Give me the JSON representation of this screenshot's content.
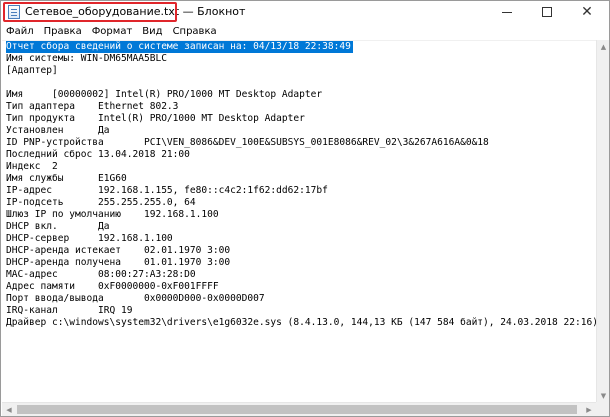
{
  "window": {
    "title": "Сетевое_оборудование.txt — Блокнот",
    "app_icon": "notepad-icon",
    "buttons": {
      "minimize": "—",
      "maximize": "☐",
      "close": "✕"
    }
  },
  "menu": {
    "items": [
      {
        "label": "Файл"
      },
      {
        "label": "Правка"
      },
      {
        "label": "Формат"
      },
      {
        "label": "Вид"
      },
      {
        "label": "Справка"
      }
    ]
  },
  "editor": {
    "selection_color": "#0078d7",
    "lines": [
      "Отчет сбора сведений о системе записан на: 04/13/18 22:38:49",
      "Имя системы: WIN-DM65MAA5BLC",
      "[Адаптер]",
      "",
      "Имя     [00000002] Intel(R) PRO/1000 MT Desktop Adapter",
      "Тип адаптера    Ethernet 802.3",
      "Тип продукта    Intel(R) PRO/1000 MT Desktop Adapter",
      "Установлен      Да",
      "ID PNP-устройства       PCI\\VEN_8086&DEV_100E&SUBSYS_001E8086&REV_02\\3&267A616A&0&18",
      "Последний сброс 13.04.2018 21:00",
      "Индекс  2",
      "Имя службы      E1G60",
      "IP-адрес        192.168.1.155, fe80::c4c2:1f62:dd62:17bf",
      "IP-подсеть      255.255.255.0, 64",
      "Шлюз IP по умолчанию    192.168.1.100",
      "DHCP вкл.       Да",
      "DHCP-сервер     192.168.1.100",
      "DHCP-аренда истекает    02.01.1970 3:00",
      "DHCP-аренда получена    01.01.1970 3:00",
      "MAC-адрес       08:00:27:A3:28:D0",
      "Адрес памяти    0xF0000000-0xF001FFFF",
      "Порт ввода/вывода       0x0000D000-0x0000D007",
      "IRQ-канал       IRQ 19",
      "Драйвер c:\\windows\\system32\\drivers\\e1g6032e.sys (8.4.13.0, 144,13 КБ (147 584 байт), 24.03.2018 22:16)"
    ]
  }
}
